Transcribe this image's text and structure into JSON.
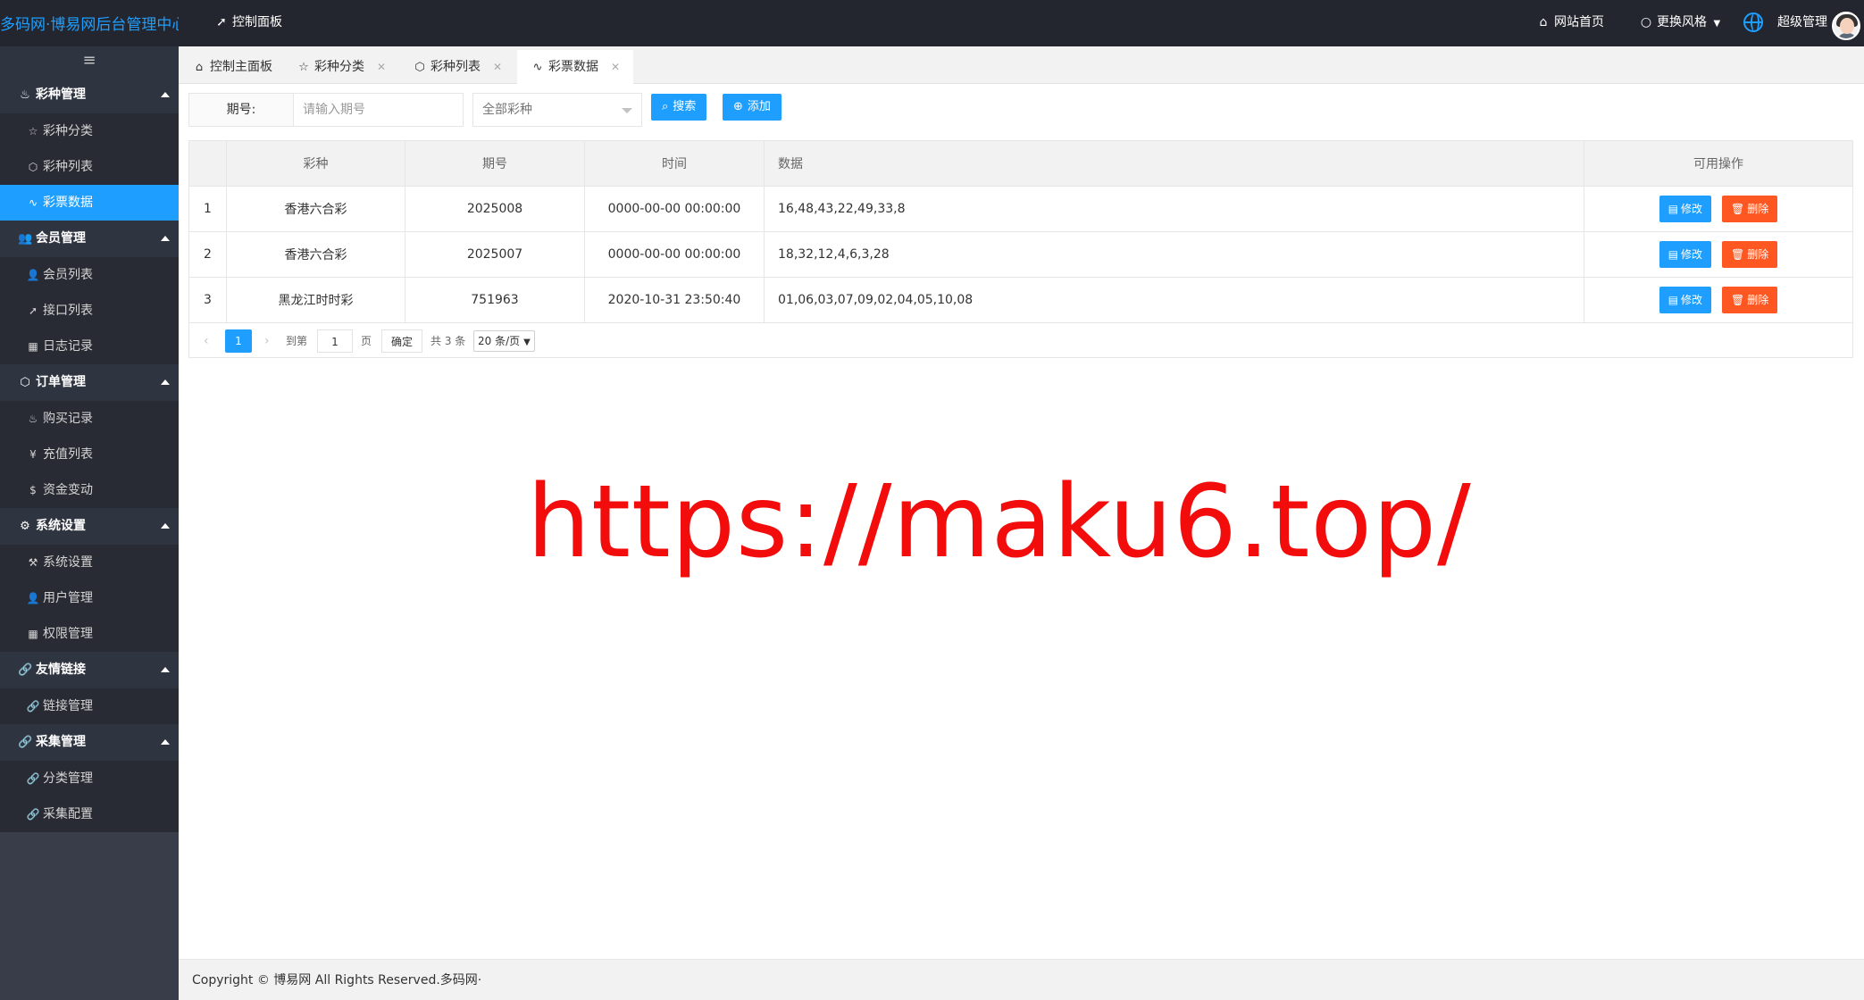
{
  "header": {
    "logo": "多码网·博易网后台管理中心",
    "control_panel": "控制面板",
    "site_home": "网站首页",
    "change_theme": "更换风格",
    "admin_name": "超级管理"
  },
  "sidebar": {
    "toggle_icon": "hamburger-icon",
    "groups": [
      {
        "title": "彩种管理",
        "icon": "fire-icon",
        "items": [
          {
            "label": "彩种分类",
            "icon": "star-icon"
          },
          {
            "label": "彩种列表",
            "icon": "cube-icon"
          },
          {
            "label": "彩票数据",
            "icon": "pulse-icon",
            "active": true
          }
        ]
      },
      {
        "title": "会员管理",
        "icon": "users-icon",
        "items": [
          {
            "label": "会员列表",
            "icon": "user-icon"
          },
          {
            "label": "接口列表",
            "icon": "send-icon"
          },
          {
            "label": "日志记录",
            "icon": "calendar-icon"
          }
        ]
      },
      {
        "title": "订单管理",
        "icon": "cube-icon",
        "items": [
          {
            "label": "购买记录",
            "icon": "fire-icon"
          },
          {
            "label": "充值列表",
            "icon": "yen-icon"
          },
          {
            "label": "资金变动",
            "icon": "dollar-icon"
          }
        ]
      },
      {
        "title": "系统设置",
        "icon": "gear-icon",
        "items": [
          {
            "label": "系统设置",
            "icon": "wrench-icon"
          },
          {
            "label": "用户管理",
            "icon": "user-icon"
          },
          {
            "label": "权限管理",
            "icon": "calendar-icon"
          }
        ]
      },
      {
        "title": "友情链接",
        "icon": "link-icon",
        "items": [
          {
            "label": "链接管理",
            "icon": "link-icon"
          }
        ]
      },
      {
        "title": "采集管理",
        "icon": "link-icon",
        "items": [
          {
            "label": "分类管理",
            "icon": "link-icon"
          },
          {
            "label": "采集配置",
            "icon": "link-icon"
          }
        ]
      }
    ]
  },
  "tabs": [
    {
      "label": "控制主面板",
      "icon": "home-icon",
      "closable": false
    },
    {
      "label": "彩种分类",
      "icon": "star-icon",
      "closable": true
    },
    {
      "label": "彩种列表",
      "icon": "cube-icon",
      "closable": true
    },
    {
      "label": "彩票数据",
      "icon": "pulse-icon",
      "closable": true,
      "active": true
    }
  ],
  "search": {
    "issue_label": "期号:",
    "issue_placeholder": "请输入期号",
    "kind_select": "全部彩种",
    "search_button": "搜索",
    "add_button": "添加"
  },
  "table": {
    "columns": [
      "",
      "彩种",
      "期号",
      "时间",
      "数据",
      "可用操作"
    ],
    "rows": [
      {
        "idx": "1",
        "kind": "香港六合彩",
        "issue": "2025008",
        "time": "0000-00-00 00:00:00",
        "data": "16,48,43,22,49,33,8"
      },
      {
        "idx": "2",
        "kind": "香港六合彩",
        "issue": "2025007",
        "time": "0000-00-00 00:00:00",
        "data": "18,32,12,4,6,3,28"
      },
      {
        "idx": "3",
        "kind": "黑龙江时时彩",
        "issue": "751963",
        "time": "2020-10-31 23:50:40",
        "data": "01,06,03,07,09,02,04,05,10,08"
      }
    ],
    "edit_label": "修改",
    "delete_label": "删除"
  },
  "pager": {
    "current_page": "1",
    "goto_prefix": "到第",
    "goto_value": "1",
    "goto_suffix": "页",
    "confirm": "确定",
    "total": "共 3 条",
    "page_size": "20 条/页"
  },
  "watermark": "https://maku6.top/",
  "footer": "Copyright © 博易网 All Rights Reserved.多码网·",
  "colors": {
    "topbar": "#23262e",
    "sidebar": "#393d49",
    "accent": "#1e9fff",
    "danger": "#ff5722",
    "watermark": "#f20c0c"
  }
}
